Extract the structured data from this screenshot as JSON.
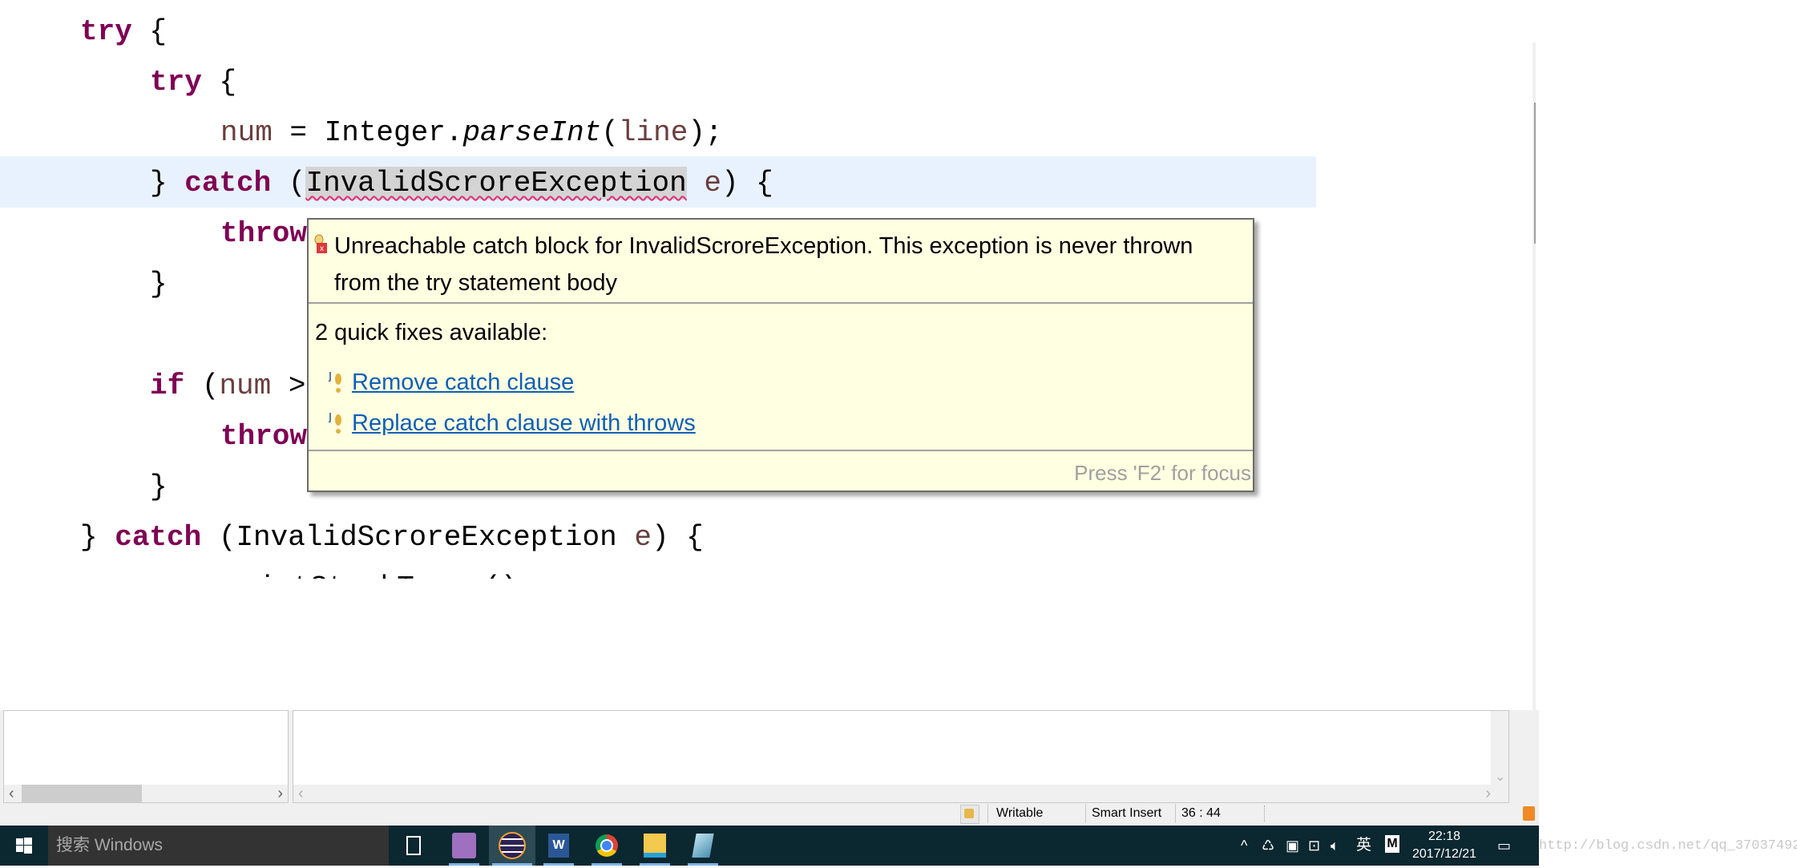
{
  "editor": {
    "lines": {
      "l1_kw": "try",
      "l1_rest": " {",
      "l2_kw": "try",
      "l2_rest": " {",
      "l3_var": "num",
      "l3_a": " = Integer.",
      "l3_method": "parseInt",
      "l3_b": "(",
      "l3_arg": "line",
      "l3_c": ");",
      "l4_a": "} ",
      "l4_kw": "catch",
      "l4_b": " (",
      "l4_type": "InvalidScroreException",
      "l4_c": " ",
      "l4_var": "e",
      "l4_d": ") {",
      "l5_kw": "throw",
      "l6": "}",
      "l8_kw": "if",
      "l8_a": " (",
      "l8_var": "num",
      "l8_b": " >",
      "l9_kw": "throw",
      "l10": "}",
      "l11_a": "} ",
      "l11_kw": "catch",
      "l11_b": " (InvalidScroreException ",
      "l11_var": "e",
      "l11_c": ") {",
      "l12": "e.printStackTrace();"
    }
  },
  "tooltip": {
    "message": "Unreachable catch block for InvalidScroreException. This exception is never thrown from the try statement body",
    "quick_fixes_label": "2 quick fixes available:",
    "fixes": [
      {
        "label": "Remove catch clause"
      },
      {
        "label": "Replace catch clause with throws"
      }
    ],
    "footer": "Press 'F2' for focus",
    "icon": "error-lightbulb-icon",
    "link_color": "#0f5fb8"
  },
  "status_bar": {
    "writable": "Writable",
    "insert_mode": "Smart Insert",
    "position": "36 : 44"
  },
  "taskbar": {
    "search_placeholder": "搜索 Windows",
    "apps": [
      "task-view",
      "app-owl",
      "eclipse",
      "word",
      "chrome",
      "file-explorer",
      "notepad"
    ],
    "ime": "英",
    "ime_mode": "M",
    "time": "22:18",
    "date": "2017/12/21"
  },
  "watermark": "http://blog.csdn.net/qq_37037492",
  "colors": {
    "keyword": "#7f0055",
    "local_var": "#6a3e3e",
    "current_line": "#e8f2fe",
    "tooltip_bg": "#ffffe1",
    "taskbar": "#0b2730"
  }
}
